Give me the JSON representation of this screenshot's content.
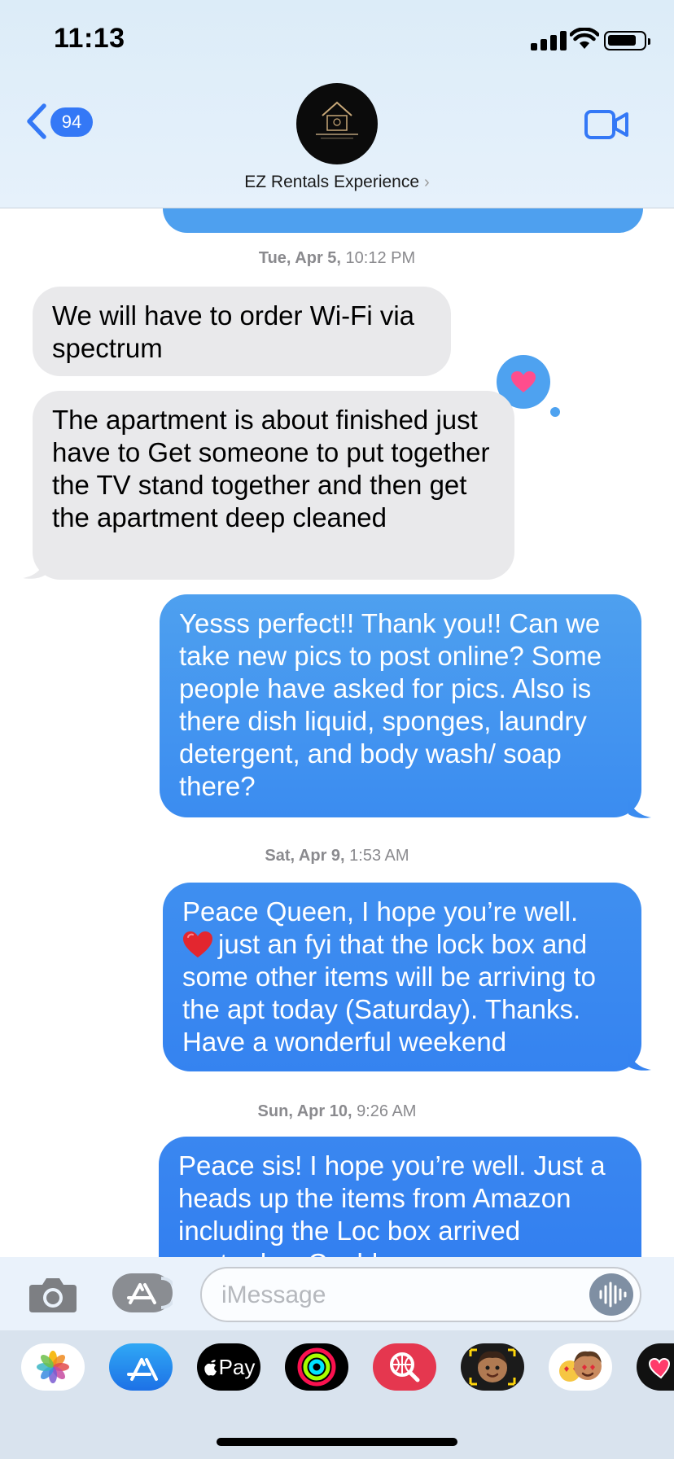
{
  "status_bar": {
    "time": "11:13"
  },
  "header": {
    "back_badge": "94",
    "contact_name": "EZ Rentals Experience",
    "contact_chevron": "›"
  },
  "messages": [
    {
      "type": "timestamp",
      "day": "Tue, Apr 5,",
      "time": "10:12 PM"
    },
    {
      "type": "received",
      "text": "We will have to order Wi-Fi via spectrum"
    },
    {
      "type": "received",
      "text": "The apartment is about finished just have to  Get someone to put together the TV stand together and then get the apartment deep cleaned",
      "tapback": "heart"
    },
    {
      "type": "sent",
      "text": "Yesss perfect!! Thank you!! Can we take new pics to post online? Some people have asked for pics. Also is there dish liquid, sponges, laundry detergent, and body wash/ soap there?"
    },
    {
      "type": "timestamp",
      "day": "Sat, Apr 9,",
      "time": "1:53 AM"
    },
    {
      "type": "sent",
      "text_line1": "Peace Queen, I hope you’re well.",
      "text_rest": "just an fyi that the lock box and some other items will be arriving to the apt today (Saturday). Thanks. Have a wonderful weekend",
      "emoji": "red-heart"
    },
    {
      "type": "timestamp",
      "day": "Sun, Apr 10,",
      "time": "9:26 AM"
    },
    {
      "type": "sent",
      "text": "Peace sis! I hope you’re well. Just a heads up the items from Amazon including the Loc box arrived yesterday. Could you"
    }
  ],
  "input": {
    "placeholder": "iMessage"
  },
  "app_drawer": {
    "apple_pay_label": "Pay"
  },
  "colors": {
    "sent_top": "#4ea0ef",
    "sent_bottom": "#2f7cf0",
    "received": "#e9e9eb",
    "accent": "#3478f6"
  },
  "icons": [
    "back-chevron-icon",
    "video-camera-icon",
    "camera-icon",
    "app-store-icon",
    "audio-message-icon",
    "photos-app-icon",
    "apple-pay-icon",
    "activity-app-icon",
    "web-search-app-icon",
    "memoji-icon"
  ]
}
